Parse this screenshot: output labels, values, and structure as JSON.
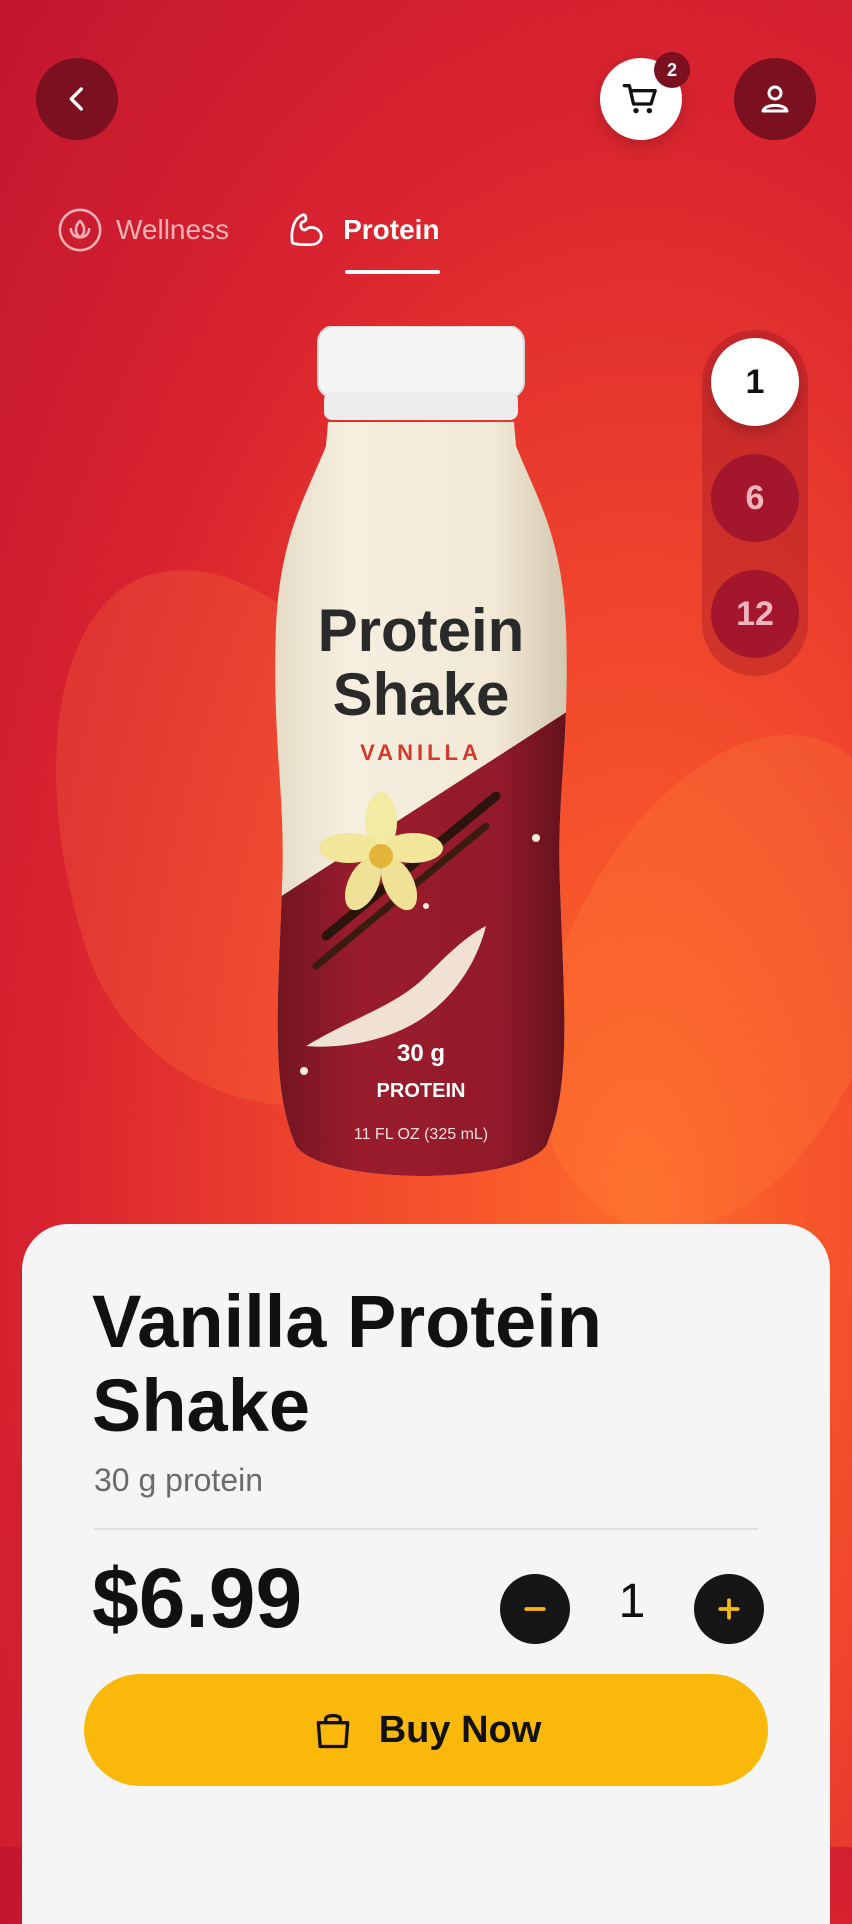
{
  "header": {
    "back_icon": "chevron-left-icon",
    "cart_icon": "cart-icon",
    "cart_count": "2",
    "profile_icon": "user-icon"
  },
  "tabs": [
    {
      "label": "Wellness",
      "icon": "lotus-icon",
      "active": false
    },
    {
      "label": "Protein",
      "icon": "muscle-icon",
      "active": true
    }
  ],
  "pack_sizes": [
    "1",
    "6",
    "12"
  ],
  "selected_pack": "1",
  "bottle": {
    "brand_line1": "Protein",
    "brand_line2": "Shake",
    "flavor": "VANILLA",
    "protein_amount": "30 g",
    "protein_label": "PROTEIN",
    "volume": "11 FL OZ (325 mL)"
  },
  "product": {
    "title": "Vanilla Protein Shake",
    "subtitle": "30 g protein",
    "price": "$6.99",
    "quantity": "1"
  },
  "actions": {
    "minus_icon": "minus-icon",
    "plus_icon": "plus-icon",
    "buy_label": "Buy Now",
    "bag_icon": "shopping-bag-icon"
  },
  "colors": {
    "accent": "#f9b80a",
    "brand_red": "#d9232f",
    "dark_red": "#7a1020"
  }
}
